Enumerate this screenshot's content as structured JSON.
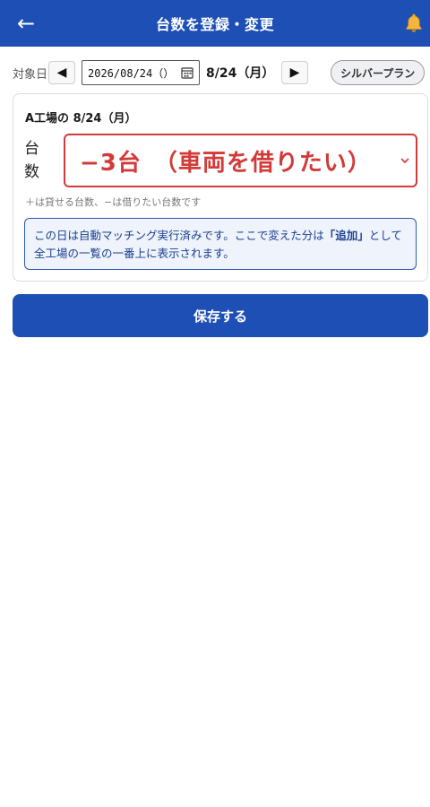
{
  "header": {
    "back_label": "←",
    "title": "台数を登録・変更"
  },
  "date_row": {
    "label": "対象日",
    "prev_label": "◀",
    "next_label": "▶",
    "date_value": "2026/08/24（）",
    "date_display": "8/24（月）",
    "plan_label": "シルバープラン"
  },
  "card": {
    "title": "A工場の 8/24（月）",
    "count_label": "台数",
    "count_value": "−3台　（車両を借りたい）",
    "hint": "＋は貸せる台数、−は借りたい台数です",
    "info_prefix": "この日は自動マッチング実行済みです。ここで変えた分は",
    "info_emphasis": "「追加」",
    "info_suffix": "として全工場の一覧の一番上に表示されます。"
  },
  "save_label": "保存する",
  "colors": {
    "primary": "#1e4fb5",
    "alert_red": "#d33a3a",
    "info_bg": "#eef3fc"
  }
}
